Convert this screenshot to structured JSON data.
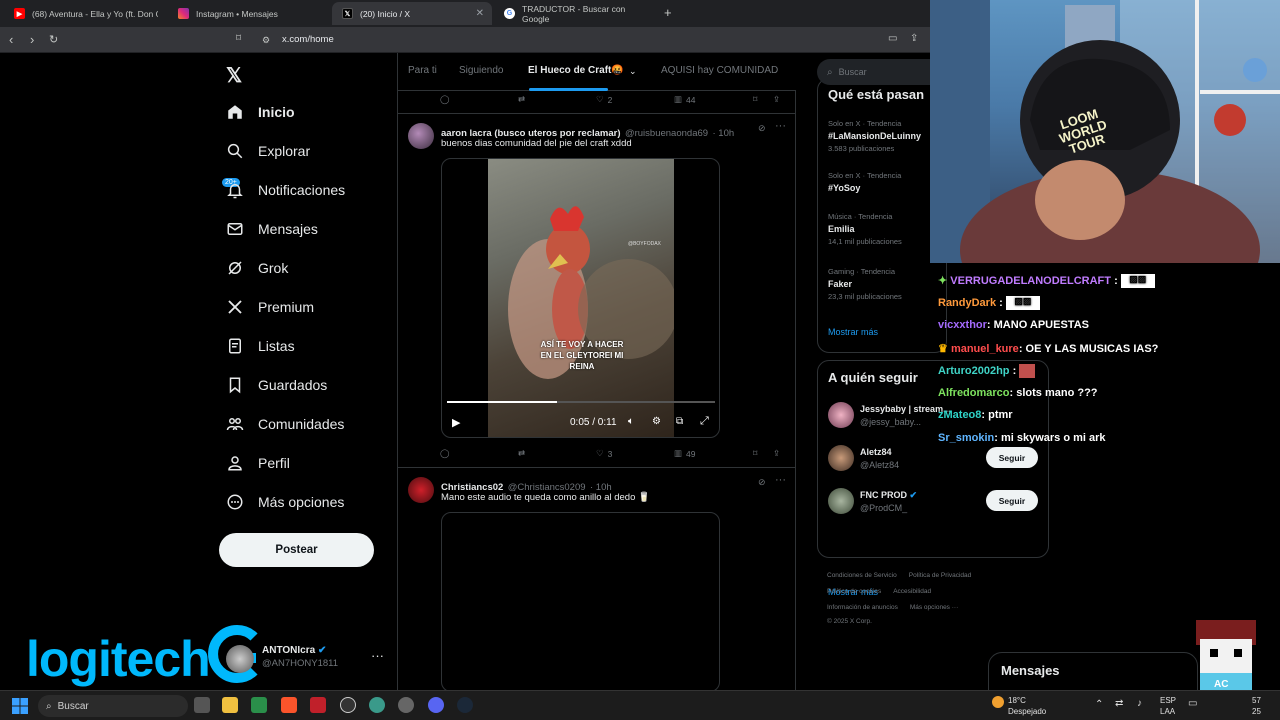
{
  "browser": {
    "tabs": [
      {
        "title": "(68) Aventura - Ella y Yo (ft. Don Omar",
        "active": false
      },
      {
        "title": "Instagram • Mensajes",
        "active": false
      },
      {
        "title": "(20) Inicio / X",
        "active": true
      },
      {
        "title": "TRADUCTOR - Buscar con Google",
        "active": false
      }
    ],
    "url": "x.com/home"
  },
  "sidebar": {
    "items": [
      {
        "label": "Inicio"
      },
      {
        "label": "Explorar"
      },
      {
        "label": "Notificaciones"
      },
      {
        "label": "Mensajes"
      },
      {
        "label": "Grok"
      },
      {
        "label": "Premium"
      },
      {
        "label": "Listas"
      },
      {
        "label": "Guardados"
      },
      {
        "label": "Comunidades"
      },
      {
        "label": "Perfil"
      },
      {
        "label": "Más opciones"
      }
    ],
    "notif_badge": "20+",
    "post_button": "Postear",
    "account": {
      "name": "ANTONIcra",
      "handle": "@AN7HONY1811"
    }
  },
  "timeline": {
    "tabs": [
      {
        "label": "Para ti"
      },
      {
        "label": "Siguiendo"
      },
      {
        "label": "El Hueco de Craft🤬"
      },
      {
        "label": "AQUISI hay COMUNIDAD"
      }
    ],
    "top_actions": {
      "likes": "2",
      "views": "44"
    },
    "tweet1": {
      "name": "aaron lacra (busco uteros por reclamar)",
      "handle": "@ruisbuenaonda69",
      "time": "· 10h",
      "text": "buenos dias comunidad del pie del craft xddd",
      "video_caption": "ASÍ TE VOY A HACER EN EL GLEYTOREI MI REINA",
      "video_watermark": "@BOYFODAX",
      "video_time": "0:05 / 0:11",
      "progress": 0.41,
      "likes": "3",
      "views": "49"
    },
    "tweet2": {
      "name": "Christiancs02",
      "handle": "@Christiancs0209",
      "time": "· 10h",
      "text": "Mano este audio te queda como anillo al dedo 🥛"
    }
  },
  "right": {
    "search_placeholder": "Buscar",
    "trends_title": "Qué está pasan",
    "trends": [
      {
        "context": "Solo en X · Tendencia",
        "name": "#LaMansionDeLuinny",
        "count": "3.583 publicaciones"
      },
      {
        "context": "Solo en X · Tendencia",
        "name": "#YoSoy",
        "count": ""
      },
      {
        "context": "Música · Tendencia",
        "name": "Emilia",
        "count": "14,1 mil publicaciones"
      },
      {
        "context": "Gaming · Tendencia",
        "name": "Faker",
        "count": "23,3 mil publicaciones"
      }
    ],
    "show_more": "Mostrar más",
    "follow_title": "A quién seguir",
    "follow": [
      {
        "name": "Jessybaby | stream...",
        "handle": "@jessy_baby..."
      },
      {
        "name": "Aletz84",
        "handle": "@Aletz84",
        "button": "Seguir"
      },
      {
        "name": "FNC PROD",
        "handle": "@ProdCM_",
        "button": "Seguir"
      }
    ],
    "follow_more": "Mostrar más",
    "footer": [
      [
        "Condiciones de Servicio",
        "Política de Privacidad"
      ],
      [
        "Política de cookies",
        "Accesibilidad"
      ],
      [
        "Información de anuncios",
        "Más opciones ···"
      ],
      [
        "© 2025 X Corp."
      ]
    ],
    "messages_label": "Mensajes"
  },
  "stream": {
    "cap_text": "LOOM WORLD TOUR",
    "chat": [
      {
        "user": "VERRUGADELANODELCRAFT",
        "msg": "",
        "color": "#c07cff",
        "emote": true
      },
      {
        "user": "RandyDark",
        "msg": "",
        "color": "#ff9a3c",
        "emote": true
      },
      {
        "user": "vicxxthor",
        "msg": ": MANO APUESTAS",
        "color": "#a56bff"
      },
      {
        "user": "manuel_kure",
        "msg": ": OE Y LAS MUSICAS IAS?",
        "color": "#ff4d4d"
      },
      {
        "user": "Arturo2002hp",
        "msg": "",
        "color": "#3fd4c7",
        "emote": true
      },
      {
        "user": "Alfredomarco",
        "msg": ": slots mano ???",
        "color": "#7ee35f"
      },
      {
        "user": "zMateo8",
        "msg": ": ptmr",
        "color": "#2fd3c8"
      },
      {
        "user": "Sr_smokin",
        "msg": ": mi skywars o mi ark",
        "color": "#5fb5ff"
      }
    ],
    "logo": "logitech",
    "avatar_tag": "AC"
  },
  "taskbar": {
    "search": "Buscar",
    "weather_temp": "18°C",
    "weather_desc": "Despejado",
    "lang1": "ESP",
    "lang2": "LAA",
    "clock1": "57",
    "clock2": "25"
  }
}
